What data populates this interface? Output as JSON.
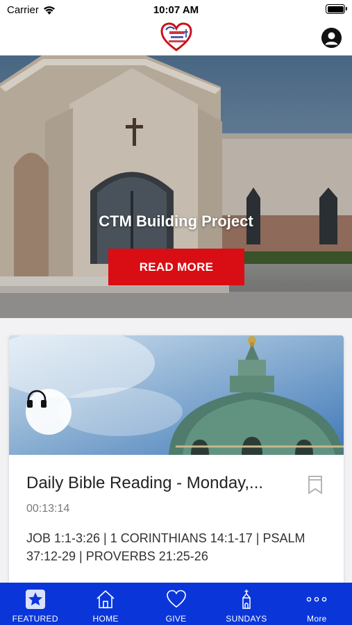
{
  "status_bar": {
    "carrier": "Carrier",
    "time": "10:07 AM"
  },
  "nav": {
    "logo_alt": "Christ's Touch Ministries"
  },
  "hero": {
    "title": "CTM Building Project",
    "button_label": "READ MORE"
  },
  "card": {
    "title": "Daily Bible Reading - Monday,...",
    "duration": "00:13:14",
    "description": "JOB 1:1-3:26 | 1 CORINTHIANS 14:1-17 | PSALM 37:12-29 | PROVERBS 21:25-26",
    "media_icon": "headphones-icon",
    "bookmark_icon": "bookmark-icon"
  },
  "tabs": [
    {
      "label": "FEATURED",
      "icon": "star-icon",
      "active": true
    },
    {
      "label": "HOME",
      "icon": "house-icon",
      "active": false
    },
    {
      "label": "GIVE",
      "icon": "heart-icon",
      "active": false
    },
    {
      "label": "SUNDAYS",
      "icon": "church-icon",
      "active": false
    },
    {
      "label": "More",
      "icon": "more-icon",
      "active": false
    }
  ],
  "colors": {
    "accent_red": "#d90d14",
    "tab_bar_blue": "#0a36d9"
  }
}
